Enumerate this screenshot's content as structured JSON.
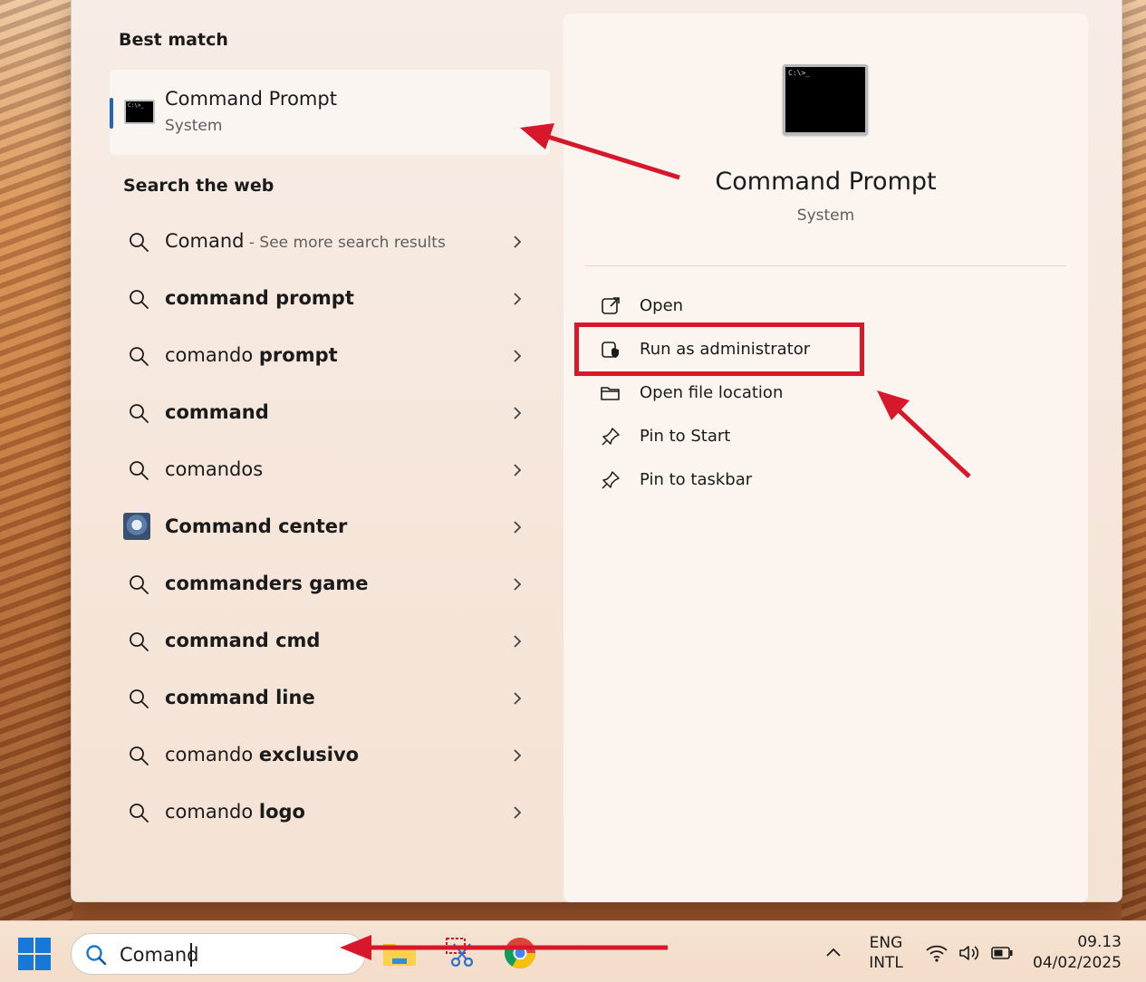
{
  "best_match": {
    "title": "Best match",
    "name": "Command Prompt",
    "type": "System"
  },
  "search_web": {
    "title": "Search the web",
    "items": [
      {
        "prefix": "Comand",
        "bold": "",
        "suffix": " - See more search results",
        "icon": "search-icon"
      },
      {
        "prefix": "",
        "bold": "command prompt",
        "suffix": "",
        "icon": "search-icon"
      },
      {
        "prefix": "comando ",
        "bold": "prompt",
        "suffix": "",
        "icon": "search-icon"
      },
      {
        "prefix": "",
        "bold": "command",
        "suffix": "",
        "icon": "search-icon"
      },
      {
        "prefix": "comandos",
        "bold": "",
        "suffix": "",
        "icon": "search-icon"
      },
      {
        "prefix": "",
        "bold": "Command center",
        "suffix": "",
        "icon": "command-center-thumbnail"
      },
      {
        "prefix": "",
        "bold": "commanders game",
        "suffix": "",
        "icon": "search-icon"
      },
      {
        "prefix": "",
        "bold": "command cmd",
        "suffix": "",
        "icon": "search-icon"
      },
      {
        "prefix": "",
        "bold": "command line",
        "suffix": "",
        "icon": "search-icon"
      },
      {
        "prefix": "comando ",
        "bold": "exclusivo",
        "suffix": "",
        "icon": "search-icon"
      },
      {
        "prefix": "comando ",
        "bold": "logo",
        "suffix": "",
        "icon": "search-icon"
      }
    ]
  },
  "detail": {
    "name": "Command Prompt",
    "type": "System",
    "actions": [
      {
        "label": "Open",
        "icon": "open-external-icon"
      },
      {
        "label": "Run as administrator",
        "icon": "admin-shield-icon"
      },
      {
        "label": "Open file location",
        "icon": "folder-icon"
      },
      {
        "label": "Pin to Start",
        "icon": "pin-icon"
      },
      {
        "label": "Pin to taskbar",
        "icon": "pin-icon"
      }
    ]
  },
  "taskbar": {
    "search_value": "Comand",
    "language_line1": "ENG",
    "language_line2": "INTL",
    "time": "09.13",
    "date": "04/02/2025"
  },
  "colors": {
    "accent": "#1e64c8",
    "annotation_red": "#d7182a",
    "windows_blue": "#1679d7"
  }
}
